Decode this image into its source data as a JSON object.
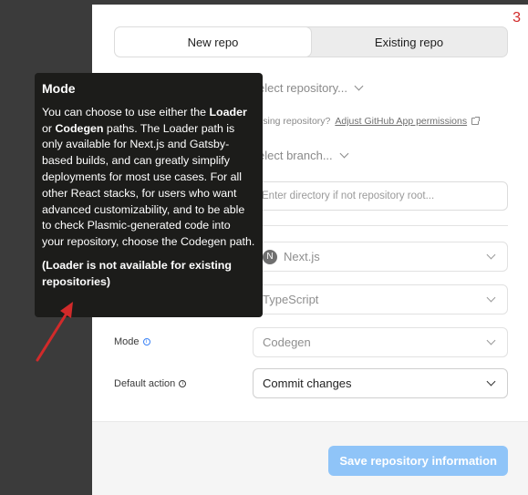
{
  "step_number": "3",
  "tabs": [
    {
      "label": "New repo",
      "active": true
    },
    {
      "label": "Existing repo",
      "active": false
    }
  ],
  "repo_select": {
    "placeholder": "elect repository..."
  },
  "missing_note": {
    "text": "ssing repository?",
    "link": "Adjust GitHub App permissions"
  },
  "branch_select": {
    "placeholder": "elect branch..."
  },
  "directory_input": {
    "placeholder": "Enter directory if not repository root..."
  },
  "framework_select": {
    "value": "Next.js"
  },
  "language_select": {
    "value": "TypeScript"
  },
  "mode": {
    "label": "Mode",
    "value": "Codegen"
  },
  "default_action": {
    "label": "Default action",
    "value": "Commit changes"
  },
  "save_button": {
    "label": "Save repository information"
  },
  "tooltip": {
    "title": "Mode",
    "p1_a": "You can choose to use either the ",
    "p1_loader": "Loader",
    "p1_b": " or ",
    "p1_codegen": "Codegen",
    "p1_c": " paths. The Loader path is only available for Next.js and Gatsby-based builds, and can greatly simplify deployments for most use cases. For all other React stacks, for users who want advanced customizability, and to be able to check Plasmic-generated code into your repository, choose the Codegen path.",
    "p2": "(Loader is not available for existing repositories)"
  },
  "colors": {
    "accent_button": "#8fc4f8",
    "annotation_red": "#d12a2a",
    "tooltip_bg": "#1c1c1a"
  }
}
